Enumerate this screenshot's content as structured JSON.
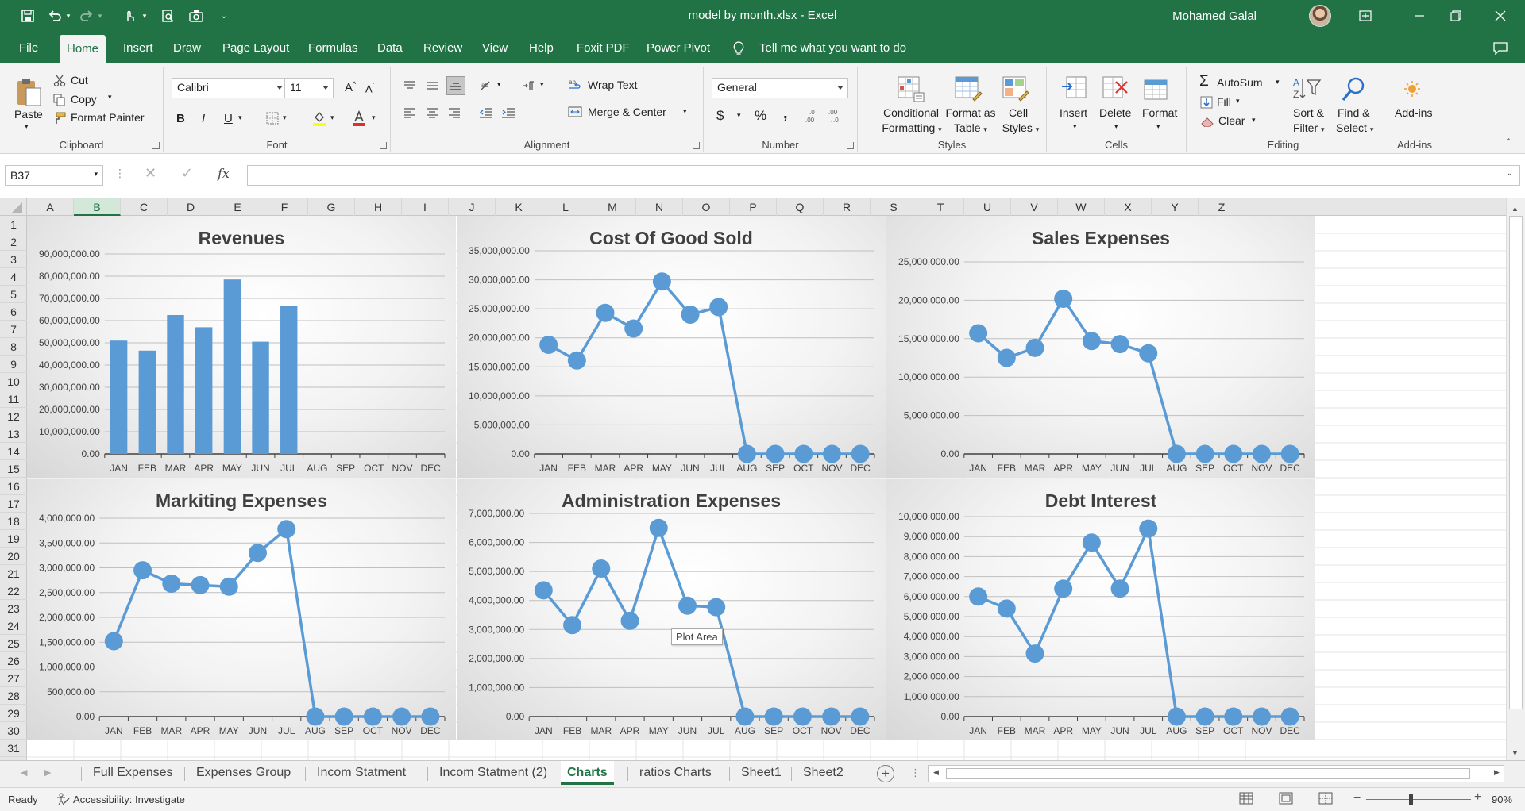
{
  "window": {
    "title": "model by month.xlsx  -  Excel",
    "user": "Mohamed Galal"
  },
  "menu": {
    "tabs": [
      "File",
      "Home",
      "Insert",
      "Draw",
      "Page Layout",
      "Formulas",
      "Data",
      "Review",
      "View",
      "Help",
      "Foxit PDF",
      "Power Pivot"
    ],
    "active": "Home",
    "tell_me": "Tell me what you want to do"
  },
  "ribbon": {
    "clipboard": {
      "name": "Clipboard",
      "paste": "Paste",
      "cut": "Cut",
      "copy": "Copy",
      "format_painter": "Format Painter"
    },
    "font": {
      "name": "Font",
      "family": "Calibri",
      "size": "11"
    },
    "alignment": {
      "name": "Alignment",
      "wrap_text": "Wrap Text",
      "merge_center": "Merge & Center"
    },
    "number": {
      "name": "Number",
      "format": "General",
      "currency": "$",
      "percent": "%",
      "comma": ","
    },
    "styles": {
      "name": "Styles",
      "conditional": [
        "Conditional",
        "Formatting"
      ],
      "format_table": [
        "Format as",
        "Table"
      ],
      "cell_styles": [
        "Cell",
        "Styles"
      ]
    },
    "cells": {
      "name": "Cells",
      "insert": "Insert",
      "delete": "Delete",
      "format": "Format"
    },
    "editing": {
      "name": "Editing",
      "autosum": "AutoSum",
      "fill": "Fill",
      "clear": "Clear",
      "sort_filter": [
        "Sort &",
        "Filter"
      ],
      "find_select": [
        "Find &",
        "Select"
      ]
    },
    "addins": {
      "name": "Add-ins",
      "label": "Add-ins"
    }
  },
  "formula_bar": {
    "name_box": "B37",
    "fx": "fx",
    "value": ""
  },
  "grid": {
    "columns": [
      "A",
      "B",
      "C",
      "D",
      "E",
      "F",
      "G",
      "H",
      "I",
      "J",
      "K",
      "L",
      "M",
      "N",
      "O",
      "P",
      "Q",
      "R",
      "S",
      "T",
      "U",
      "V",
      "W",
      "X",
      "Y",
      "Z"
    ],
    "rows": [
      "1",
      "2",
      "3",
      "4",
      "5",
      "6",
      "7",
      "8",
      "9",
      "10",
      "11",
      "12",
      "13",
      "14",
      "15",
      "16",
      "17",
      "18",
      "19",
      "20",
      "21",
      "22",
      "23",
      "24",
      "25",
      "26",
      "27",
      "28",
      "29",
      "30",
      "31"
    ],
    "selected_column": "B"
  },
  "tooltip": "Plot Area",
  "chart_data": [
    {
      "type": "bar",
      "title": "Revenues",
      "categories": [
        "JAN",
        "FEB",
        "MAR",
        "APR",
        "MAY",
        "JUN",
        "JUL",
        "AUG",
        "SEP",
        "OCT",
        "NOV",
        "DEC"
      ],
      "values": [
        51000000,
        46500000,
        62500000,
        57000000,
        78500000,
        50500000,
        66500000,
        0,
        0,
        0,
        0,
        0
      ],
      "ylim": [
        0,
        90000000
      ],
      "yticks": [
        "0.00",
        "10,000,000.00",
        "20,000,000.00",
        "30,000,000.00",
        "40,000,000.00",
        "50,000,000.00",
        "60,000,000.00",
        "70,000,000.00",
        "80,000,000.00",
        "90,000,000.00"
      ],
      "color": "#5b9bd5",
      "grid": true
    },
    {
      "type": "line",
      "title": "Cost Of Good Sold",
      "categories": [
        "JAN",
        "FEB",
        "MAR",
        "APR",
        "MAY",
        "JUN",
        "JUL",
        "AUG",
        "SEP",
        "OCT",
        "NOV",
        "DEC"
      ],
      "values": [
        18800000,
        16100000,
        24300000,
        21600000,
        29700000,
        24000000,
        25300000,
        0,
        0,
        0,
        0,
        0
      ],
      "ylim": [
        0,
        35000000
      ],
      "yticks": [
        "0.00",
        "5,000,000.00",
        "10,000,000.00",
        "15,000,000.00",
        "20,000,000.00",
        "25,000,000.00",
        "30,000,000.00",
        "35,000,000.00"
      ],
      "color": "#5b9bd5",
      "grid": true
    },
    {
      "type": "line",
      "title": "Sales Expenses",
      "categories": [
        "JAN",
        "FEB",
        "MAR",
        "APR",
        "MAY",
        "JUN",
        "JUL",
        "AUG",
        "SEP",
        "OCT",
        "NOV",
        "DEC"
      ],
      "values": [
        15700000,
        12500000,
        13800000,
        20200000,
        14700000,
        14300000,
        13100000,
        0,
        0,
        0,
        0,
        0
      ],
      "ylim": [
        0,
        25000000
      ],
      "yticks": [
        "0.00",
        "5,000,000.00",
        "10,000,000.00",
        "15,000,000.00",
        "20,000,000.00",
        "25,000,000.00"
      ],
      "color": "#5b9bd5",
      "grid": true
    },
    {
      "type": "line",
      "title": "Markiting Expenses",
      "categories": [
        "JAN",
        "FEB",
        "MAR",
        "APR",
        "MAY",
        "JUN",
        "JUL",
        "AUG",
        "SEP",
        "OCT",
        "NOV",
        "DEC"
      ],
      "values": [
        1520000,
        2950000,
        2680000,
        2650000,
        2620000,
        3300000,
        3780000,
        0,
        0,
        0,
        0,
        0
      ],
      "ylim": [
        0,
        4000000
      ],
      "yticks": [
        "0.00",
        "500,000.00",
        "1,000,000.00",
        "1,500,000.00",
        "2,000,000.00",
        "2,500,000.00",
        "3,000,000.00",
        "3,500,000.00",
        "4,000,000.00"
      ],
      "color": "#5b9bd5",
      "grid": true
    },
    {
      "type": "line",
      "title": "Administration Expenses",
      "categories": [
        "JAN",
        "FEB",
        "MAR",
        "APR",
        "MAY",
        "JUN",
        "JUL",
        "AUG",
        "SEP",
        "OCT",
        "NOV",
        "DEC"
      ],
      "values": [
        4350000,
        3150000,
        5100000,
        3300000,
        6500000,
        3820000,
        3770000,
        0,
        0,
        0,
        0,
        0
      ],
      "ylim": [
        0,
        7000000
      ],
      "yticks": [
        "0.00",
        "1,000,000.00",
        "2,000,000.00",
        "3,000,000.00",
        "4,000,000.00",
        "5,000,000.00",
        "6,000,000.00",
        "7,000,000.00"
      ],
      "color": "#5b9bd5",
      "grid": true
    },
    {
      "type": "line",
      "title": "Debt Interest",
      "categories": [
        "JAN",
        "FEB",
        "MAR",
        "APR",
        "MAY",
        "JUN",
        "JUL",
        "AUG",
        "SEP",
        "OCT",
        "NOV",
        "DEC"
      ],
      "values": [
        6000000,
        5400000,
        3150000,
        6400000,
        8700000,
        6400000,
        9400000,
        0,
        0,
        0,
        0,
        0
      ],
      "ylim": [
        0,
        10000000
      ],
      "yticks": [
        "0.00",
        "1,000,000.00",
        "2,000,000.00",
        "3,000,000.00",
        "4,000,000.00",
        "5,000,000.00",
        "6,000,000.00",
        "7,000,000.00",
        "8,000,000.00",
        "9,000,000.00",
        "10,000,000.00"
      ],
      "color": "#5b9bd5",
      "grid": true
    }
  ],
  "sheets": {
    "tabs": [
      "Full Expenses",
      "Expenses Group",
      "Incom Statment",
      "Incom Statment (2)",
      "Charts",
      "ratios Charts",
      "Sheet1",
      "Sheet2"
    ],
    "active": "Charts"
  },
  "status": {
    "ready": "Ready",
    "accessibility": "Accessibility: Investigate",
    "zoom": "90%"
  }
}
